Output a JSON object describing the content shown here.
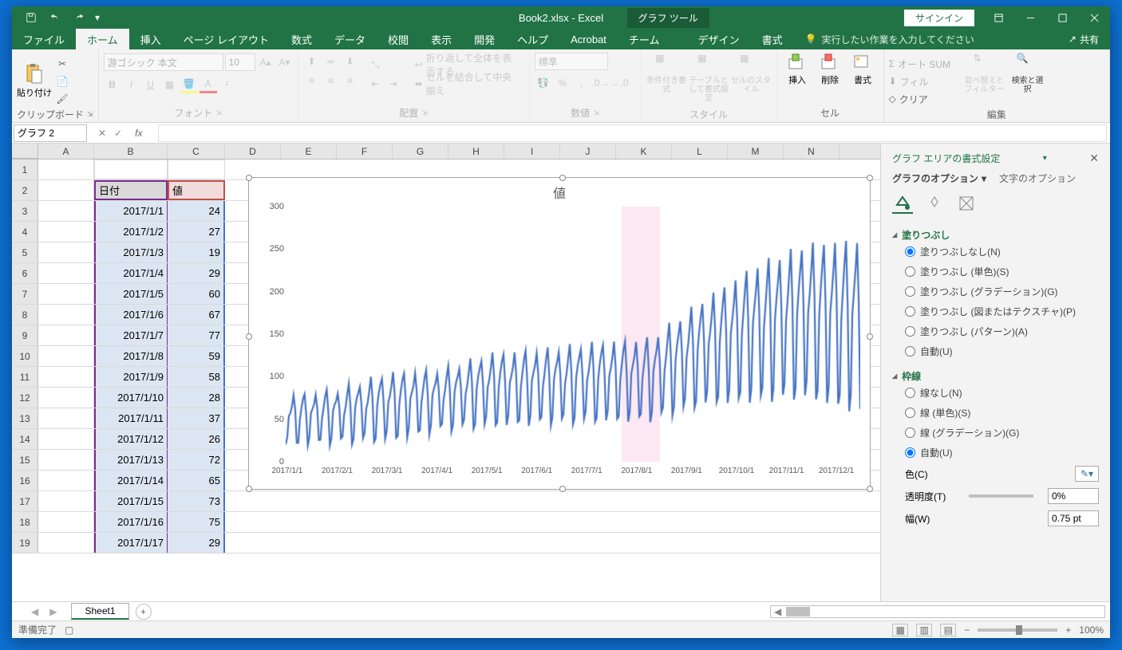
{
  "title": "Book2.xlsx - Excel",
  "chart_tools": "グラフ ツール",
  "signin": "サインイン",
  "tabs": [
    "ファイル",
    "ホーム",
    "挿入",
    "ページ レイアウト",
    "数式",
    "データ",
    "校閲",
    "表示",
    "開発",
    "ヘルプ",
    "Acrobat",
    "チーム",
    "デザイン",
    "書式"
  ],
  "tell_me": "実行したい作業を入力してください",
  "share": "共有",
  "ribbon": {
    "clipboard": {
      "paste": "貼り付け",
      "label": "クリップボード"
    },
    "font": {
      "name": "游ゴシック 本文",
      "size": "10",
      "label": "フォント"
    },
    "align": {
      "wrap": "折り返して全体を表示する",
      "merge": "セルを結合して中央揃え",
      "label": "配置"
    },
    "number": {
      "fmt": "標準",
      "label": "数値"
    },
    "styles": {
      "cond": "条件付き書式",
      "table": "テーブルとして書式設定",
      "cell": "セルのスタイル",
      "label": "スタイル"
    },
    "cells": {
      "insert": "挿入",
      "delete": "削除",
      "format": "書式",
      "label": "セル"
    },
    "editing": {
      "sum": "オート SUM",
      "fill": "フィル",
      "clear": "クリア",
      "sort": "並べ替えとフィルター",
      "find": "検索と選択",
      "label": "編集"
    }
  },
  "namebox": "グラフ 2",
  "columns": [
    "A",
    "B",
    "C",
    "D",
    "E",
    "F",
    "G",
    "H",
    "I",
    "J",
    "K",
    "L",
    "M",
    "N"
  ],
  "table": {
    "header_date": "日付",
    "header_val": "値",
    "rows": [
      {
        "d": "2017/1/1",
        "v": 24
      },
      {
        "d": "2017/1/2",
        "v": 27
      },
      {
        "d": "2017/1/3",
        "v": 19
      },
      {
        "d": "2017/1/4",
        "v": 29
      },
      {
        "d": "2017/1/5",
        "v": 60
      },
      {
        "d": "2017/1/6",
        "v": 67
      },
      {
        "d": "2017/1/7",
        "v": 77
      },
      {
        "d": "2017/1/8",
        "v": 59
      },
      {
        "d": "2017/1/9",
        "v": 58
      },
      {
        "d": "2017/1/10",
        "v": 28
      },
      {
        "d": "2017/1/11",
        "v": 37
      },
      {
        "d": "2017/1/12",
        "v": 26
      },
      {
        "d": "2017/1/13",
        "v": 72
      },
      {
        "d": "2017/1/14",
        "v": 65
      },
      {
        "d": "2017/1/15",
        "v": 73
      },
      {
        "d": "2017/1/16",
        "v": 75
      },
      {
        "d": "2017/1/17",
        "v": 29
      }
    ]
  },
  "chart_data": {
    "type": "line",
    "title": "値",
    "ylim": [
      0,
      300
    ],
    "yticks": [
      0,
      50,
      100,
      150,
      200,
      250,
      300
    ],
    "xticks": [
      "2017/1/1",
      "2017/2/1",
      "2017/3/1",
      "2017/4/1",
      "2017/5/1",
      "2017/6/1",
      "2017/7/1",
      "2017/8/1",
      "2017/9/1",
      "2017/10/1",
      "2017/11/1",
      "2017/12/1"
    ],
    "highlight_band": {
      "start": "2017/8/1",
      "end": "2017/8/21"
    },
    "series": [
      {
        "name": "値",
        "color": "#4472c4",
        "approx_weekly_envelope": [
          {
            "x": "2017/1/1",
            "low": 22,
            "high": 78
          },
          {
            "x": "2017/2/1",
            "low": 25,
            "high": 85
          },
          {
            "x": "2017/3/1",
            "low": 28,
            "high": 105
          },
          {
            "x": "2017/4/1",
            "low": 40,
            "high": 108
          },
          {
            "x": "2017/5/1",
            "low": 45,
            "high": 128
          },
          {
            "x": "2017/6/1",
            "low": 48,
            "high": 132
          },
          {
            "x": "2017/7/1",
            "low": 50,
            "high": 140
          },
          {
            "x": "2017/8/1",
            "low": 52,
            "high": 145
          },
          {
            "x": "2017/9/1",
            "low": 70,
            "high": 190
          },
          {
            "x": "2017/10/1",
            "low": 75,
            "high": 230
          },
          {
            "x": "2017/11/1",
            "low": 78,
            "high": 255
          },
          {
            "x": "2017/12/1",
            "low": 60,
            "high": 260
          }
        ]
      }
    ]
  },
  "format_pane": {
    "title": "グラフ エリアの書式設定",
    "tab_chart": "グラフのオプション",
    "tab_text": "文字のオプション",
    "sec_fill": "塗りつぶし",
    "fill_opts": [
      "塗りつぶしなし(N)",
      "塗りつぶし (単色)(S)",
      "塗りつぶし (グラデーション)(G)",
      "塗りつぶし (図またはテクスチャ)(P)",
      "塗りつぶし (パターン)(A)",
      "自動(U)"
    ],
    "fill_selected": 0,
    "sec_line": "枠線",
    "line_opts": [
      "線なし(N)",
      "線 (単色)(S)",
      "線 (グラデーション)(G)",
      "自動(U)"
    ],
    "line_selected": 3,
    "color_lbl": "色(C)",
    "trans_lbl": "透明度(T)",
    "trans_val": "0%",
    "width_lbl": "幅(W)",
    "width_val": "0.75 pt"
  },
  "sheet_tab": "Sheet1",
  "status": "準備完了",
  "zoom": "100%"
}
